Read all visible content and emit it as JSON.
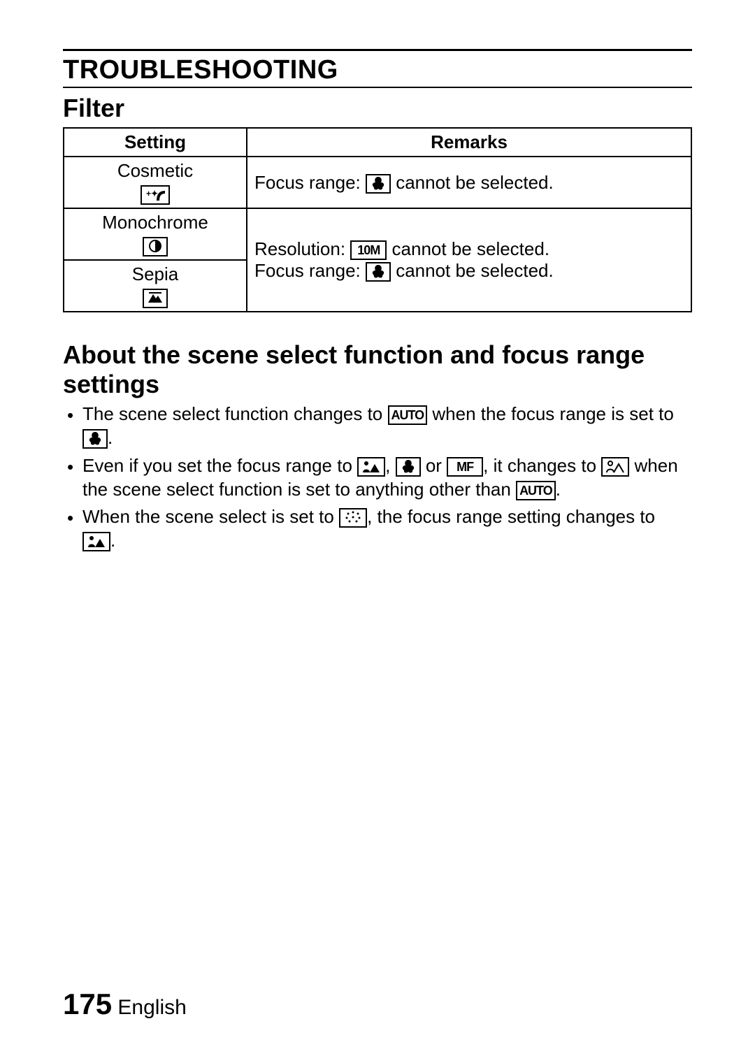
{
  "header": {
    "title": "TROUBLESHOOTING",
    "subsection": "Filter"
  },
  "table": {
    "headers": {
      "setting": "Setting",
      "remarks": "Remarks"
    },
    "rows": {
      "cosmetic": {
        "label": "Cosmetic",
        "remark_prefix": "Focus range: ",
        "remark_suffix": " cannot be selected."
      },
      "monochrome": {
        "label": "Monochrome"
      },
      "sepia": {
        "label": "Sepia"
      },
      "shared_remarks": {
        "line1_prefix": "Resolution: ",
        "line1_suffix": " cannot be selected.",
        "line2_prefix": "Focus range: ",
        "line2_suffix": " cannot be selected."
      }
    }
  },
  "about": {
    "heading": "About the scene select function and focus range settings",
    "bullets": {
      "b1a": "The scene select function changes to ",
      "b1b": " when the focus range is set to ",
      "b1c": ".",
      "b2a": "Even if you set the focus range to ",
      "b2b": ", ",
      "b2c": " or ",
      "b2d": ", it changes to ",
      "b2e": " when the scene select function is set to anything other than ",
      "b2f": ".",
      "b3a": "When the scene select is set to ",
      "b3b": ", the focus range setting changes to ",
      "b3c": "."
    }
  },
  "icons": {
    "auto": "AUTO",
    "mf": "MF",
    "tenm": "10M"
  },
  "footer": {
    "page": "175",
    "lang": "English"
  }
}
